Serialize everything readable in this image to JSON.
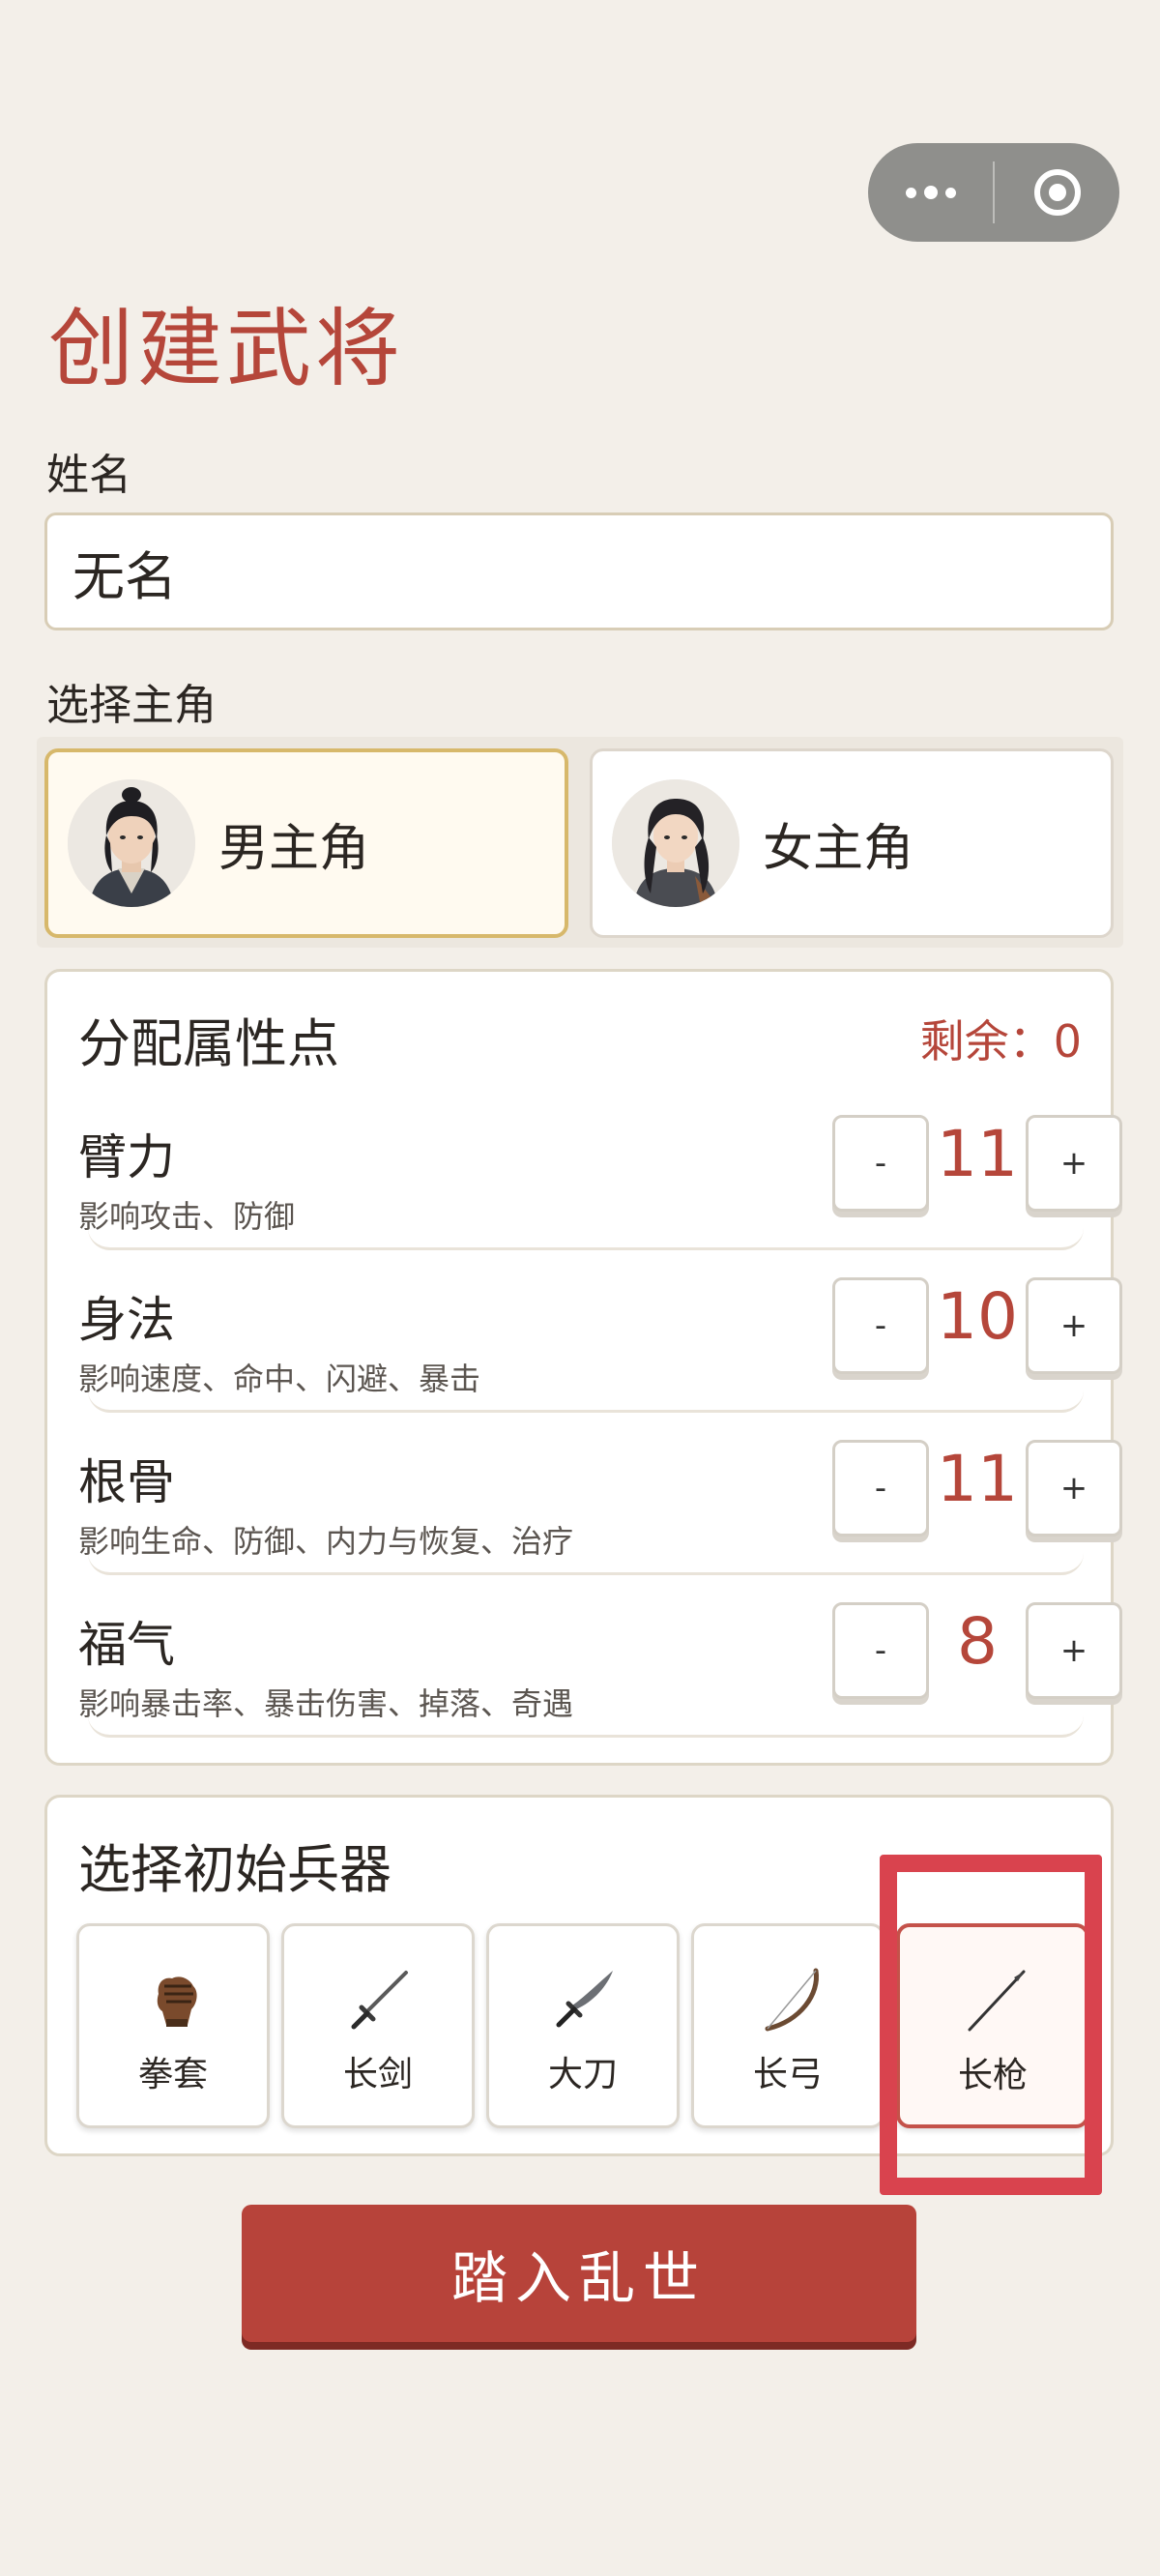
{
  "capsule": {
    "more_icon": "more-dots-icon",
    "close_icon": "target-circle-icon"
  },
  "page": {
    "title": "创建武将"
  },
  "name_field": {
    "label": "姓名",
    "value": "无名"
  },
  "hero": {
    "label": "选择主角",
    "options": [
      {
        "label": "男主角",
        "selected": true
      },
      {
        "label": "女主角",
        "selected": false
      }
    ]
  },
  "attributes": {
    "title": "分配属性点",
    "remaining": "剩余：0",
    "minus_label": "-",
    "plus_label": "+",
    "items": [
      {
        "name": "臂力",
        "desc": "影响攻击、防御",
        "value": "11"
      },
      {
        "name": "身法",
        "desc": "影响速度、命中、闪避、暴击",
        "value": "10"
      },
      {
        "name": "根骨",
        "desc": "影响生命、防御、内力与恢复、治疗",
        "value": "11"
      },
      {
        "name": "福气",
        "desc": "影响暴击率、暴击伤害、掉落、奇遇",
        "value": "8"
      }
    ]
  },
  "weapons": {
    "title": "选择初始兵器",
    "items": [
      {
        "label": "拳套",
        "icon": "gauntlet-icon",
        "selected": false
      },
      {
        "label": "长剑",
        "icon": "sword-icon",
        "selected": false
      },
      {
        "label": "大刀",
        "icon": "broadsword-icon",
        "selected": false
      },
      {
        "label": "长弓",
        "icon": "bow-icon",
        "selected": false
      },
      {
        "label": "长枪",
        "icon": "spear-icon",
        "selected": true
      }
    ]
  },
  "enter_button": {
    "label": "踏入乱世"
  },
  "colors": {
    "accent": "#b5463a",
    "background": "#f3efe9",
    "selected_gold": "#d7b86b",
    "highlight": "#d9434e"
  }
}
